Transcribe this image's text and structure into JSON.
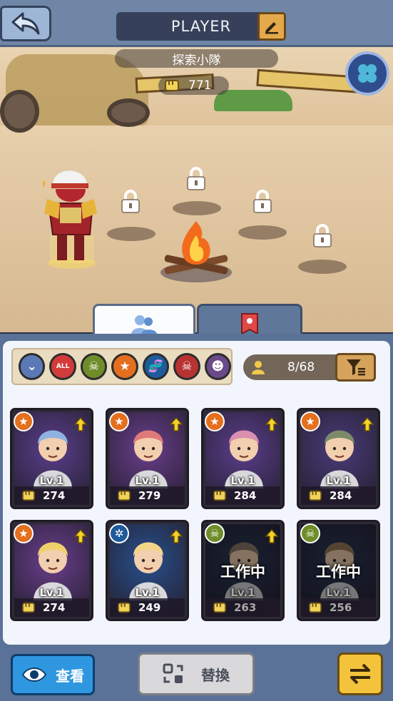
{
  "header": {
    "title": "PLAYER",
    "back_icon": "back-arrow-icon",
    "edit_icon": "pencil-icon"
  },
  "scene": {
    "team_name": "探索小隊",
    "team_power": "771",
    "clover_icon": "clover-icon",
    "locked_slots": 4,
    "hero_name_icon": "samurai-hero"
  },
  "tabs": [
    {
      "name": "heroes-tab",
      "icon": "people-icon",
      "active": true
    },
    {
      "name": "banner-tab",
      "icon": "banner-icon",
      "active": false
    }
  ],
  "filters": [
    {
      "name": "dropdown-filter",
      "color": "#5b79b7",
      "glyph": "⌄"
    },
    {
      "name": "all-filter",
      "color": "#d33b3b",
      "glyph": "ALL"
    },
    {
      "name": "skull-green-filter",
      "color": "#6f8c2a",
      "glyph": "☠"
    },
    {
      "name": "star-filter",
      "color": "#e46f1e",
      "glyph": "★"
    },
    {
      "name": "dna-filter",
      "color": "#1f5b9c",
      "glyph": "🧬"
    },
    {
      "name": "skull-red-filter",
      "color": "#b83232",
      "glyph": "☠"
    },
    {
      "name": "mask-filter",
      "color": "#6a4a8a",
      "glyph": "☻"
    }
  ],
  "roster": {
    "count_text": "8/68"
  },
  "heroes": [
    {
      "level": "Lv.1",
      "power": "274",
      "badge": "star",
      "bg": "#5b3e8c",
      "upgrade": true,
      "working": false,
      "skin": "#8fb3e0"
    },
    {
      "level": "Lv.1",
      "power": "279",
      "badge": "star",
      "bg": "#6a3e8c",
      "upgrade": true,
      "working": false,
      "skin": "#e07a7a"
    },
    {
      "level": "Lv.1",
      "power": "284",
      "badge": "star",
      "bg": "#5b3e8c",
      "upgrade": true,
      "working": false,
      "skin": "#d98fb0"
    },
    {
      "level": "Lv.1",
      "power": "284",
      "badge": "star",
      "bg": "#4a3b78",
      "upgrade": true,
      "working": false,
      "skin": "#7d8a6a"
    },
    {
      "level": "Lv.1",
      "power": "274",
      "badge": "star",
      "bg": "#6a3e8c",
      "upgrade": true,
      "working": false,
      "skin": "#f0d06a"
    },
    {
      "level": "Lv.1",
      "power": "249",
      "badge": "dna",
      "bg": "#28508c",
      "upgrade": true,
      "working": false,
      "skin": "#f3d58a"
    },
    {
      "level": "Lv.1",
      "power": "263",
      "badge": "skull",
      "bg": "#2d3b5c",
      "upgrade": true,
      "working": true,
      "skin": "#8a7a6a"
    },
    {
      "level": "Lv.1",
      "power": "256",
      "badge": "skull",
      "bg": "#2d3b5c",
      "upgrade": false,
      "working": true,
      "skin": "#9a7a5a"
    }
  ],
  "working_label": "工作中",
  "bottom": {
    "view_label": "查看",
    "replace_label": "替換",
    "swap_icon": "swap-arrows-icon"
  },
  "colors": {
    "panel": "#5a7297",
    "view_button": "#2f97e0",
    "swap_button": "#f3c33b",
    "sort_button": "#d6a35c"
  }
}
